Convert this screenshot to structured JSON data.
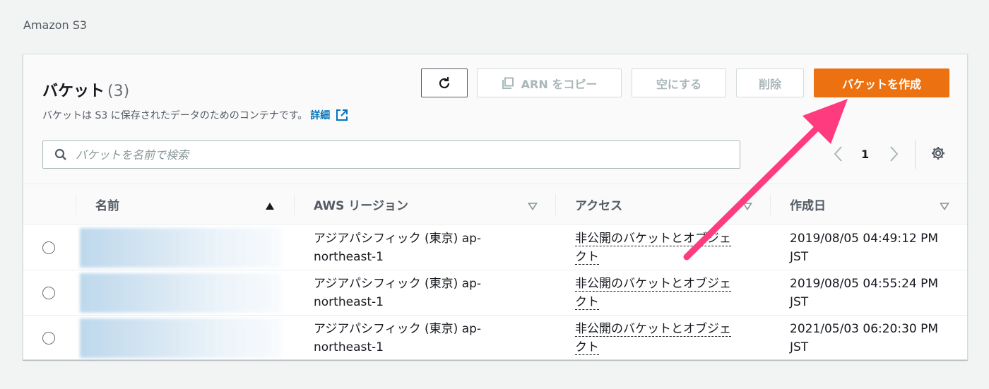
{
  "breadcrumb": "Amazon S3",
  "panel": {
    "title": "バケット",
    "count": "(3)",
    "description": "バケットは S3 に保存されたデータのためのコンテナです。",
    "details_link": "詳細"
  },
  "toolbar": {
    "refresh_icon": "refresh-icon",
    "copy_arn_label": "ARN をコピー",
    "empty_label": "空にする",
    "delete_label": "削除",
    "create_label": "バケットを作成"
  },
  "search": {
    "placeholder": "バケットを名前で検索"
  },
  "pagination": {
    "page": "1"
  },
  "columns": {
    "name": "名前",
    "region": "AWS リージョン",
    "access": "アクセス",
    "created": "作成日"
  },
  "rows": [
    {
      "region_line1": "アジアパシフィック (東京) ap-",
      "region_line2": "northeast-1",
      "access_line1": "非公開のバケットとオブジェ",
      "access_line2": "クト",
      "created_line1": "2019/08/05 04:49:12 PM",
      "created_line2": "JST"
    },
    {
      "region_line1": "アジアパシフィック (東京) ap-",
      "region_line2": "northeast-1",
      "access_line1": "非公開のバケットとオブジェ",
      "access_line2": "クト",
      "created_line1": "2019/08/05 04:55:24 PM",
      "created_line2": "JST"
    },
    {
      "region_line1": "アジアパシフィック (東京) ap-",
      "region_line2": "northeast-1",
      "access_line1": "非公開のバケットとオブジェ",
      "access_line2": "クト",
      "created_line1": "2021/05/03 06:20:30 PM",
      "created_line2": "JST"
    }
  ],
  "colors": {
    "accent": "#ec7211",
    "link": "#0073bb",
    "annotation_arrow": "#ff3b7f"
  }
}
